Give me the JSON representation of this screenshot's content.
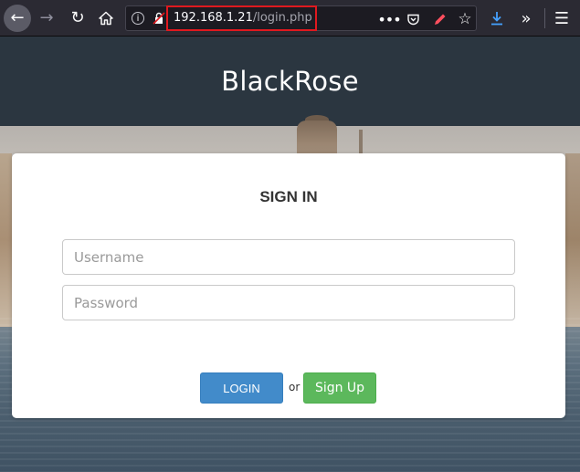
{
  "browser": {
    "url_host": "192.168.1.21",
    "url_path": "/login.php",
    "icons": {
      "back": "back-arrow-icon",
      "forward": "forward-arrow-icon",
      "reload": "reload-icon",
      "home": "home-icon",
      "info": "info-icon",
      "lock": "insecure-lock-icon",
      "more": "more-dots-icon",
      "pocket": "pocket-icon",
      "pen": "pen-icon",
      "star": "bookmark-star-icon",
      "download": "download-icon",
      "overflow": "overflow-chevrons-icon",
      "menu": "hamburger-menu-icon"
    },
    "highlight_color": "#e0191f"
  },
  "site": {
    "title": "BlackRose",
    "header_color": "#2b3640"
  },
  "login_form": {
    "heading": "SIGN IN",
    "username": {
      "placeholder": "Username",
      "value": ""
    },
    "password": {
      "placeholder": "Password",
      "value": ""
    },
    "login_label": "LOGIN",
    "or_label": "or",
    "signup_label": "Sign Up",
    "colors": {
      "login": "#428bca",
      "signup": "#5cb85c"
    }
  }
}
